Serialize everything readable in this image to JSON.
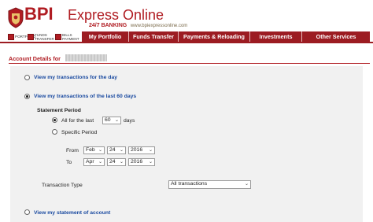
{
  "brand": {
    "name": "BPI",
    "product": "Express Online",
    "tagline_24_7": "24/7 BANKING",
    "tagline_url": "www.bpiexpressonline.com",
    "color": "#b01c22"
  },
  "quick_links": [
    {
      "label": "PORTFOLIO",
      "icon": "portfolio-icon"
    },
    {
      "label": "FUNDS TRANSFER",
      "icon": "funds-transfer-icon"
    },
    {
      "label": "BILLS PAYMENT",
      "icon": "bills-payment-icon"
    }
  ],
  "nav": {
    "items": [
      "My Portfolio",
      "Funds Transfer",
      "Payments & Reloading",
      "Investments",
      "Other Services"
    ],
    "color": "#9c1c22"
  },
  "account": {
    "label": "Account Details for"
  },
  "options": {
    "day": "View my transactions for the day",
    "sixty": "View my transactions of the last 60 days",
    "statement": "View my statement of account",
    "selected": "sixty"
  },
  "statement_period": {
    "title": "Statement Period",
    "all_for_the_last": "All for the last",
    "days_value": "60",
    "days_unit": "days",
    "specific_period": "Specific Period",
    "from_label": "From",
    "to_label": "To",
    "from": {
      "month": "Feb",
      "day": "24",
      "year": "2016"
    },
    "to": {
      "month": "Apr",
      "day": "24",
      "year": "2016"
    }
  },
  "transaction_type": {
    "label": "Transaction Type",
    "value": "All transactions"
  },
  "icons": {
    "dropdown": "chevron-down-icon"
  }
}
